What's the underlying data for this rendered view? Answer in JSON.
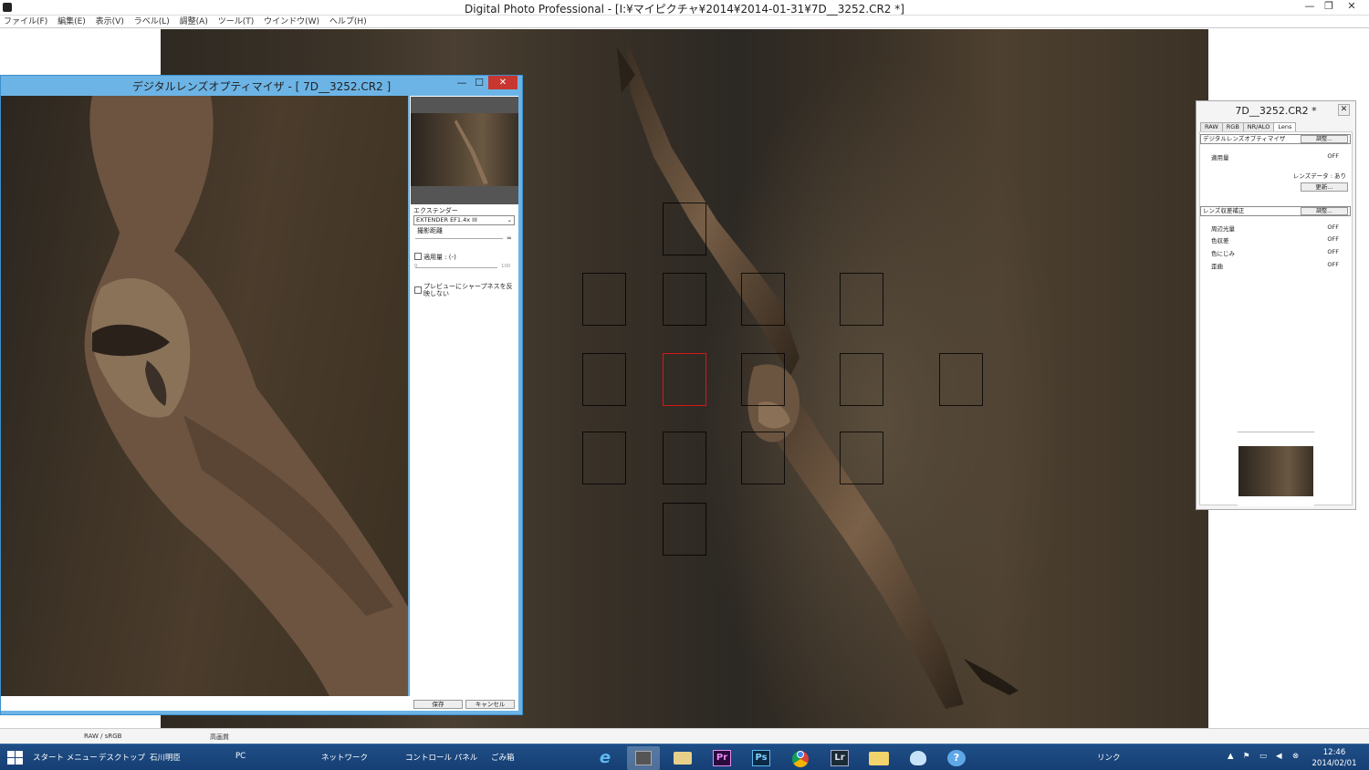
{
  "window": {
    "title": "Digital Photo Professional - [I:¥マイピクチャ¥2014¥2014-01-31¥7D__3252.CR2 *]",
    "min": "—",
    "max": "❐",
    "close": "✕"
  },
  "menu": [
    "ファイル(F)",
    "編集(E)",
    "表示(V)",
    "ラベル(L)",
    "調整(A)",
    "ツール(T)",
    "ウインドウ(W)",
    "ヘルプ(H)"
  ],
  "lens_dialog": {
    "title": "デジタルレンズオプティマイザ - [ 7D__3252.CR2 ]",
    "min": "—",
    "max": "☐",
    "close": "✕",
    "extender_label": "エクステンダー",
    "extender_value": "EXTENDER EF1.4x III",
    "distance_label": "撮影距離",
    "distance_infinity": "∞",
    "apply_label": "適用量 : (-)",
    "scale_min": "0",
    "scale_max": "100",
    "sharpness_label": "プレビューにシャープネスを反映しない",
    "save_button": "保存",
    "cancel_button": "キャンセル"
  },
  "tool_palette": {
    "title": "7D__3252.CR2 *",
    "close": "✕",
    "tabs": [
      "RAW",
      "RGB",
      "NR/ALO",
      "Lens"
    ],
    "active_tab": "Lens",
    "dlo_section": "デジタルレンズオプティマイザ",
    "adjust_button": "調整...",
    "apply_amount_label": "適用量",
    "apply_amount_value": "OFF",
    "lens_data": "レンズデータ : あり",
    "update_button": "更新...",
    "aberration_section": "レンズ収差補正",
    "aberration_adjust_button": "調整...",
    "aberrations": [
      {
        "label": "周辺光量",
        "value": "OFF"
      },
      {
        "label": "色収差",
        "value": "OFF"
      },
      {
        "label": "色にじみ",
        "value": "OFF"
      },
      {
        "label": "歪曲",
        "value": "OFF"
      }
    ]
  },
  "status": {
    "color_space": "RAW / sRGB",
    "quality": "高画質"
  },
  "taskbar": {
    "start_menu": "スタート メニュー",
    "desktop": "デスクトップ",
    "user": "石川明臣",
    "pc": "PC",
    "network": "ネットワーク",
    "control_panel": "コントロール パネル",
    "trash": "ごみ箱",
    "links": "リンク",
    "time": "12:46",
    "date": "2014/02/01",
    "apps": [
      "e",
      "",
      "",
      "Pr",
      "Ps",
      "",
      "Lr",
      "",
      "",
      ""
    ]
  },
  "colors": {
    "af_selected": "#d41818",
    "taskbar": "#1e4e86",
    "dialog_frame": "#6cb4e6"
  }
}
